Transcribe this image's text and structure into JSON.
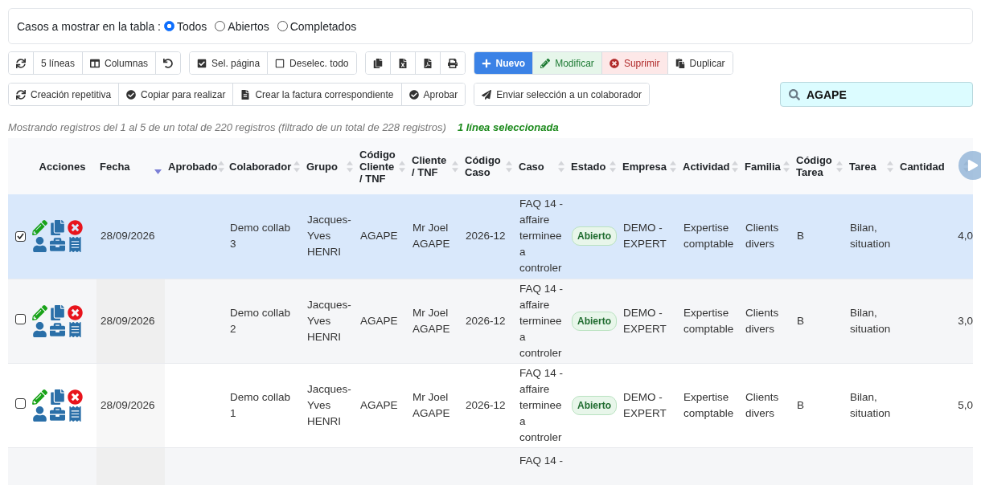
{
  "filter": {
    "label": "Casos a mostrar en la tabla :",
    "options": [
      {
        "label": "Todos",
        "selected": true
      },
      {
        "label": "Abiertos",
        "selected": false
      },
      {
        "label": "Completados",
        "selected": false
      }
    ]
  },
  "toolbar_rows": [
    [
      {
        "buttons": [
          {
            "kind": "icon"
          },
          {
            "label": "5 líneas",
            "kind": "plain"
          },
          {
            "label": "Columnas",
            "kind": "plain"
          },
          {
            "kind": "icon"
          }
        ]
      },
      {
        "buttons": [
          {
            "label": "Sel. página",
            "kind": "plain"
          },
          {
            "label": "Deselec. todo",
            "kind": "plain"
          }
        ]
      },
      {
        "buttons": [
          {
            "kind": "icon"
          },
          {
            "kind": "icon"
          },
          {
            "kind": "icon"
          },
          {
            "kind": "icon"
          }
        ]
      },
      {
        "buttons": [
          {
            "label": "Nuevo",
            "kind": "primary"
          },
          {
            "label": "Modificar",
            "kind": "success"
          },
          {
            "label": "Suprimir",
            "kind": "danger"
          },
          {
            "label": "Duplicar",
            "kind": "plain"
          }
        ]
      }
    ],
    [
      {
        "buttons": [
          {
            "label": "Creación repetitiva",
            "kind": "plain"
          },
          {
            "label": "Copiar para realizar",
            "kind": "plain"
          },
          {
            "label": "Crear la factura correspondiente",
            "kind": "plain"
          },
          {
            "label": "Aprobar",
            "kind": "plain"
          }
        ]
      },
      {
        "buttons": [
          {
            "label": "Enviar selección a un colaborador",
            "kind": "plain"
          }
        ]
      }
    ]
  ],
  "search": {
    "value": "AGAPE"
  },
  "info": "Mostrando registros del 1 al 5 de un total de 220 registros (filtrado de un total de 228 registros)",
  "selection_info": "1 línea seleccionada",
  "columns": [
    {
      "label": "Acciones"
    },
    {
      "label": "Fecha",
      "sorted": true
    },
    {
      "label": "Aprobado",
      "sorted": false
    },
    {
      "label": "Colaborador",
      "sorted": false
    },
    {
      "label": "Grupo",
      "sorted": false
    },
    {
      "label": "Código Cliente / TNF",
      "sorted": false
    },
    {
      "label": "Cliente / TNF",
      "sorted": false
    },
    {
      "label": "Código Caso",
      "sorted": false
    },
    {
      "label": "Caso",
      "sorted": false
    },
    {
      "label": "Estado",
      "sorted": false
    },
    {
      "label": "Empresa",
      "sorted": false
    },
    {
      "label": "Actividad",
      "sorted": false
    },
    {
      "label": "Familia",
      "sorted": false
    },
    {
      "label": "Código Tarea",
      "sorted": false
    },
    {
      "label": "Tarea",
      "sorted": false
    },
    {
      "label": "Cantidad",
      "sorted": false
    }
  ],
  "rows": [
    {
      "selected": true,
      "fecha": "28/09/2026",
      "colaborador": "Demo collab 3",
      "grupo": "Jacques-Yves HENRI",
      "codigo_cliente": "AGAPE",
      "cliente": "Mr Joel AGAPE",
      "codigo_caso": "2026-12",
      "caso": "FAQ 14 - affaire terminee a controler",
      "estado": "Abierto",
      "empresa": "DEMO - EXPERT",
      "actividad": "Expertise comptable",
      "familia": "Clients divers",
      "codigo_tarea": "B",
      "tarea": "Bilan, situation",
      "cantidad": "4,0"
    },
    {
      "selected": false,
      "fecha": "28/09/2026",
      "colaborador": "Demo collab 2",
      "grupo": "Jacques-Yves HENRI",
      "codigo_cliente": "AGAPE",
      "cliente": "Mr Joel AGAPE",
      "codigo_caso": "2026-12",
      "caso": "FAQ 14 - affaire terminee a controler",
      "estado": "Abierto",
      "empresa": "DEMO - EXPERT",
      "actividad": "Expertise comptable",
      "familia": "Clients divers",
      "codigo_tarea": "B",
      "tarea": "Bilan, situation",
      "cantidad": "3,0"
    },
    {
      "selected": false,
      "fecha": "28/09/2026",
      "colaborador": "Demo collab 1",
      "grupo": "Jacques-Yves HENRI",
      "codigo_cliente": "AGAPE",
      "cliente": "Mr Joel AGAPE",
      "codigo_caso": "2026-12",
      "caso": "FAQ 14 - affaire terminee a controler",
      "estado": "Abierto",
      "empresa": "DEMO - EXPERT",
      "actividad": "Expertise comptable",
      "familia": "Clients divers",
      "codigo_tarea": "B",
      "tarea": "Bilan, situation",
      "cantidad": "5,0"
    },
    {
      "caso": "FAQ 14 -"
    }
  ]
}
